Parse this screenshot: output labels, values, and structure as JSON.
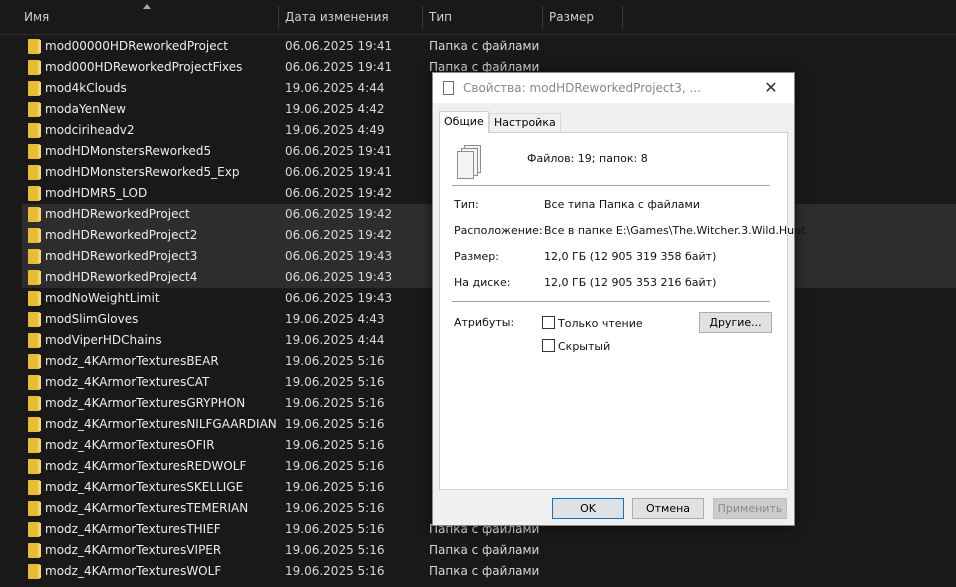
{
  "header": {
    "name": "Имя",
    "date": "Дата изменения",
    "type": "Тип",
    "size": "Размер"
  },
  "files": [
    {
      "name": "mod00000HDReworkedProject",
      "date": "06.06.2025 19:41",
      "type": "Папка с файлами",
      "selected": false
    },
    {
      "name": "mod000HDReworkedProjectFixes",
      "date": "06.06.2025 19:41",
      "type": "Папка с файлами",
      "selected": false
    },
    {
      "name": "mod4kClouds",
      "date": "19.06.2025 4:44",
      "type": "",
      "selected": false
    },
    {
      "name": "modaYenNew",
      "date": "19.06.2025 4:42",
      "type": "",
      "selected": false
    },
    {
      "name": "modciriheadv2",
      "date": "19.06.2025 4:49",
      "type": "",
      "selected": false
    },
    {
      "name": "modHDMonstersReworked5",
      "date": "06.06.2025 19:41",
      "type": "",
      "selected": false
    },
    {
      "name": "modHDMonstersReworked5_Exp",
      "date": "06.06.2025 19:41",
      "type": "",
      "selected": false
    },
    {
      "name": "modHDMR5_LOD",
      "date": "06.06.2025 19:42",
      "type": "",
      "selected": false
    },
    {
      "name": "modHDReworkedProject",
      "date": "06.06.2025 19:42",
      "type": "",
      "selected": true
    },
    {
      "name": "modHDReworkedProject2",
      "date": "06.06.2025 19:42",
      "type": "",
      "selected": true
    },
    {
      "name": "modHDReworkedProject3",
      "date": "06.06.2025 19:43",
      "type": "",
      "selected": true
    },
    {
      "name": "modHDReworkedProject4",
      "date": "06.06.2025 19:43",
      "type": "",
      "selected": true
    },
    {
      "name": "modNoWeightLimit",
      "date": "06.06.2025 19:43",
      "type": "",
      "selected": false
    },
    {
      "name": "modSlimGloves",
      "date": "19.06.2025 4:43",
      "type": "",
      "selected": false
    },
    {
      "name": "modViperHDChains",
      "date": "19.06.2025 4:44",
      "type": "",
      "selected": false
    },
    {
      "name": "modz_4KArmorTexturesBEAR",
      "date": "19.06.2025 5:16",
      "type": "",
      "selected": false
    },
    {
      "name": "modz_4KArmorTexturesCAT",
      "date": "19.06.2025 5:16",
      "type": "",
      "selected": false
    },
    {
      "name": "modz_4KArmorTexturesGRYPHON",
      "date": "19.06.2025 5:16",
      "type": "",
      "selected": false
    },
    {
      "name": "modz_4KArmorTexturesNILFGAARDIAN",
      "date": "19.06.2025 5:16",
      "type": "",
      "selected": false
    },
    {
      "name": "modz_4KArmorTexturesOFIR",
      "date": "19.06.2025 5:16",
      "type": "",
      "selected": false
    },
    {
      "name": "modz_4KArmorTexturesREDWOLF",
      "date": "19.06.2025 5:16",
      "type": "",
      "selected": false
    },
    {
      "name": "modz_4KArmorTexturesSKELLIGE",
      "date": "19.06.2025 5:16",
      "type": "",
      "selected": false
    },
    {
      "name": "modz_4KArmorTexturesTEMERIAN",
      "date": "19.06.2025 5:16",
      "type": "",
      "selected": false
    },
    {
      "name": "modz_4KArmorTexturesTHIEF",
      "date": "19.06.2025 5:16",
      "type": "Папка с файлами",
      "selected": false
    },
    {
      "name": "modz_4KArmorTexturesVIPER",
      "date": "19.06.2025 5:16",
      "type": "Папка с файлами",
      "selected": false
    },
    {
      "name": "modz_4KArmorTexturesWOLF",
      "date": "19.06.2025 5:16",
      "type": "Папка с файлами",
      "selected": false
    }
  ],
  "dialog": {
    "title": "Свойства: modHDReworkedProject3, ...",
    "close": "✕",
    "tabs": [
      "Общие",
      "Настройка"
    ],
    "summary": "Файлов: 19; папок: 8",
    "type_label": "Тип:",
    "type_value": "Все типа Папка с файлами",
    "location_label": "Расположение:",
    "location_value": "Все в папке E:\\Games\\The.Witcher.3.Wild.Hunt",
    "size_label": "Размер:",
    "size_value": "12,0 ГБ (12 905 319 358 байт)",
    "disk_label": "На диске:",
    "disk_value": "12,0 ГБ (12 905 353 216 байт)",
    "attributes_label": "Атрибуты:",
    "readonly_label": "Только чтение",
    "hidden_label": "Скрытый",
    "other_button": "Другие...",
    "ok_button": "OK",
    "cancel_button": "Отмена",
    "apply_button": "Применить"
  }
}
